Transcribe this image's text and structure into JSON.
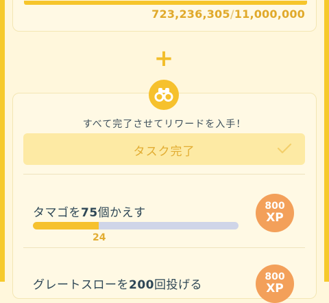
{
  "colors": {
    "accent": "#f6c12d",
    "xp_badge": "#f3a05a",
    "bar_track": "#cfd5e8",
    "text_dark": "#2e4756"
  },
  "research_progress": {
    "current": "723,236,305",
    "separator": "/",
    "goal": "11,000,000"
  },
  "plus_symbol": "+",
  "reward": {
    "icon": "binoculars-icon",
    "subtitle": "すべて完了させてリワードを入手！",
    "complete_button_label": "タスク完了"
  },
  "tasks": [
    {
      "title_prefix": "タマゴを",
      "title_number": "75",
      "title_suffix": "個かえす",
      "progress_count": "24",
      "progress_fraction": 0.32,
      "xp_value": "800",
      "xp_unit": "XP"
    },
    {
      "title_prefix": "グレートスローを",
      "title_number": "200",
      "title_suffix": "回投げる",
      "xp_value": "800",
      "xp_unit": "XP"
    }
  ]
}
